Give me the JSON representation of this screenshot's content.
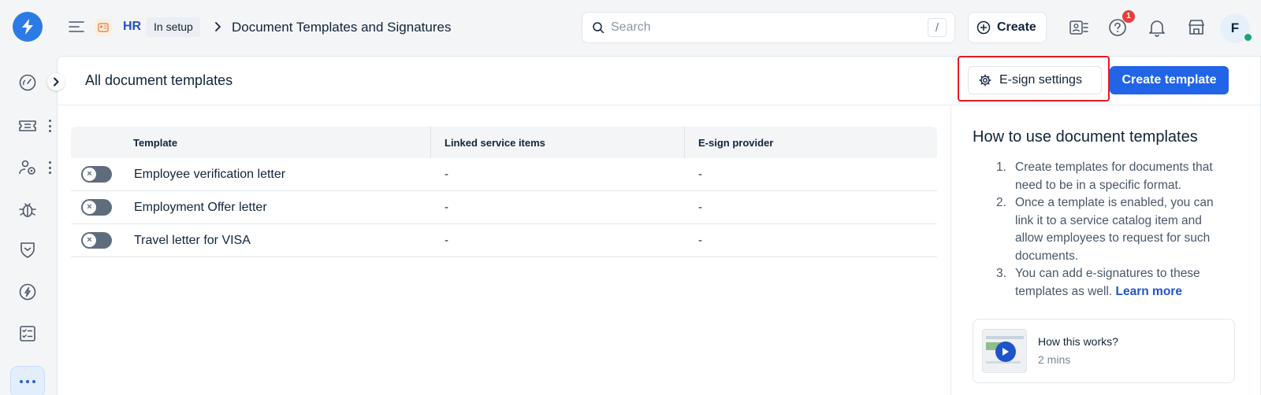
{
  "breadcrumb": {
    "module": "HR",
    "status_badge": "In setup",
    "page": "Document Templates and Signatures"
  },
  "search": {
    "placeholder": "Search",
    "shortcut": "/"
  },
  "toolbar": {
    "create_label": "Create",
    "notification_count": "1",
    "avatar_initial": "F"
  },
  "sidebar": {
    "items": [
      {
        "icon": "speedometer-icon"
      },
      {
        "icon": "ticket-icon"
      },
      {
        "icon": "people-settings-icon"
      },
      {
        "icon": "bug-icon"
      },
      {
        "icon": "shield-icon"
      },
      {
        "icon": "compass-icon"
      },
      {
        "icon": "checklist-icon"
      },
      {
        "icon": "more-icon"
      }
    ]
  },
  "main": {
    "title": "All document templates",
    "esign_settings_label": "E-sign settings",
    "create_template_label": "Create template",
    "table": {
      "columns": [
        "Template",
        "Linked service items",
        "E-sign provider"
      ],
      "rows": [
        {
          "name": "Employee verification letter",
          "linked": "-",
          "provider": "-",
          "enabled": false
        },
        {
          "name": "Employment Offer letter",
          "linked": "-",
          "provider": "-",
          "enabled": false
        },
        {
          "name": "Travel letter for VISA",
          "linked": "-",
          "provider": "-",
          "enabled": false
        }
      ]
    }
  },
  "help": {
    "title": "How to use document templates",
    "steps": [
      "Create templates for documents that need to be in a specific format.",
      "Once a template is enabled, you can link it to a service catalog item and allow employees to request for such documents.",
      "You can add e-signatures to these templates as well."
    ],
    "learn_more": "Learn more",
    "video": {
      "title": "How this works?",
      "duration": "2 mins"
    }
  },
  "colors": {
    "primary": "#2164e8",
    "highlight_border": "#e21a22",
    "toggle_off": "#5e6d7e"
  }
}
